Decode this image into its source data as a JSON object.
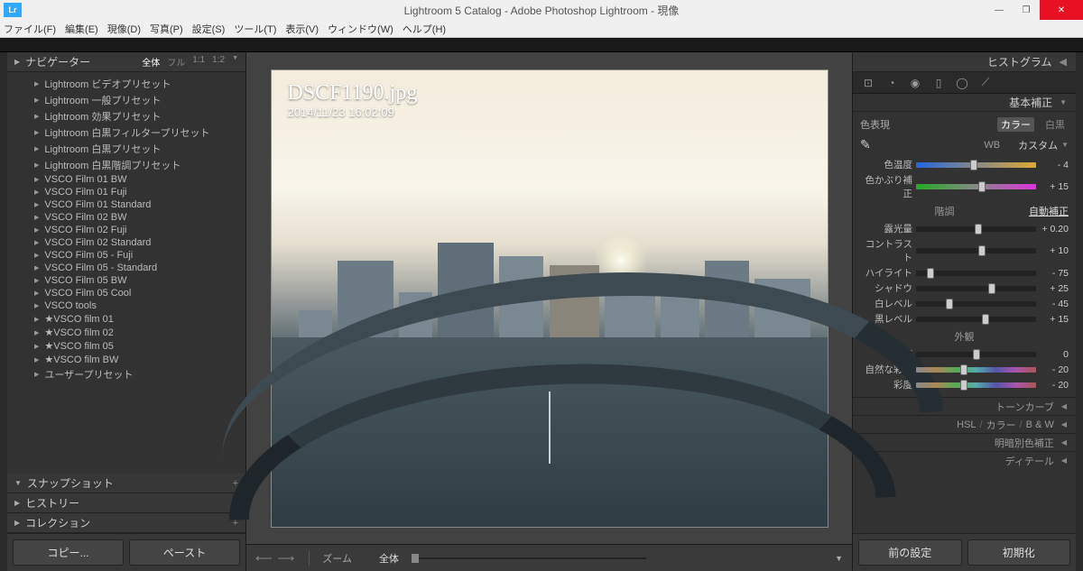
{
  "titlebar": {
    "title": "Lightroom 5 Catalog - Adobe Photoshop Lightroom - 現像",
    "logo": "Lr"
  },
  "menubar": [
    "ファイル(F)",
    "編集(E)",
    "現像(D)",
    "写真(P)",
    "設定(S)",
    "ツール(T)",
    "表示(V)",
    "ウィンドウ(W)",
    "ヘルプ(H)"
  ],
  "left": {
    "navigator": {
      "name": "ナビゲーター",
      "zoom_opts": [
        "全体",
        "フル",
        "1:1",
        "1:2"
      ],
      "active": "全体"
    },
    "presets": [
      "Lightroom ビデオプリセット",
      "Lightroom 一般プリセット",
      "Lightroom 効果プリセット",
      "Lightroom 白黒フィルタープリセット",
      "Lightroom 白黒プリセット",
      "Lightroom 白黒階調プリセット",
      "VSCO  Film 01  BW",
      "VSCO  Film 01  Fuji",
      "VSCO  Film 01  Standard",
      "VSCO  Film 02  BW",
      "VSCO  Film 02  Fuji",
      "VSCO  Film 02  Standard",
      "VSCO  Film 05 - Fuji",
      "VSCO  Film 05 - Standard",
      "VSCO  Film 05 BW",
      "VSCO  Film 05 Cool",
      "VSCO  tools",
      "★VSCO  film 01",
      "★VSCO  film 02",
      "★VSCO  film 05",
      "★VSCO  film BW",
      "ユーザープリセット"
    ],
    "sections": {
      "snapshot": "スナップショット",
      "history": "ヒストリー",
      "collection": "コレクション"
    },
    "btn_copy": "コピー...",
    "btn_paste": "ペースト"
  },
  "image": {
    "filename": "DSCF1190.jpg",
    "datetime": "2014/11/23 16:02:09"
  },
  "toolbar": {
    "zoom_lbl": "ズーム",
    "fit_lbl": "全体"
  },
  "right": {
    "histogram": "ヒストグラム",
    "basic": {
      "title": "基本補正",
      "treatment_lbl": "色表現",
      "color": "カラー",
      "bw": "白黒",
      "wb_lbl": "WB",
      "wb_val": "カスタム",
      "temp_lbl": "色温度",
      "temp_val": "- 4",
      "tint_lbl": "色かぶり補正",
      "tint_val": "+ 15",
      "tone_lbl": "階調",
      "auto_lbl": "自動補正",
      "exposure_lbl": "露光量",
      "exposure_val": "+ 0.20",
      "contrast_lbl": "コントラスト",
      "contrast_val": "+ 10",
      "highlights_lbl": "ハイライト",
      "highlights_val": "- 75",
      "shadows_lbl": "シャドウ",
      "shadows_val": "+ 25",
      "whites_lbl": "白レベル",
      "whites_val": "- 45",
      "blacks_lbl": "黒レベル",
      "blacks_val": "+ 15",
      "presence_lbl": "外観",
      "clarity_lbl": "明瞭度",
      "clarity_val": "0",
      "vibrance_lbl": "自然な彩度",
      "vibrance_val": "- 20",
      "saturation_lbl": "彩度",
      "saturation_val": "- 20"
    },
    "sections": {
      "tone_curve": "トーンカーブ",
      "hsl": "HSL",
      "color": "カラー",
      "bw": "B & W",
      "split": "明暗別色補正",
      "detail": "ディテール"
    },
    "btn_previous": "前の設定",
    "btn_reset": "初期化"
  }
}
